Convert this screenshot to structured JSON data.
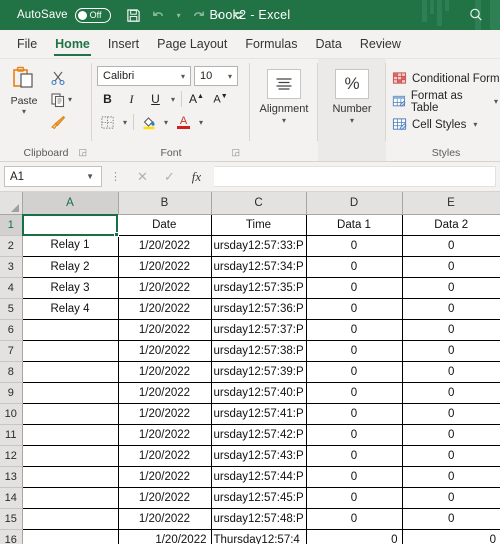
{
  "titlebar": {
    "autosave_label": "AutoSave",
    "autosave_state": "Off",
    "document_title": "Book2  -  Excel",
    "save_icon": "save-icon",
    "undo_icon": "undo-icon",
    "redo_icon": "redo-icon",
    "customize_icon": "customize-quick-access-icon",
    "search_icon": "search-icon",
    "accent_color": "#217346"
  },
  "tabs": [
    {
      "label": "File",
      "active": false
    },
    {
      "label": "Home",
      "active": true
    },
    {
      "label": "Insert",
      "active": false
    },
    {
      "label": "Page Layout",
      "active": false
    },
    {
      "label": "Formulas",
      "active": false
    },
    {
      "label": "Data",
      "active": false
    },
    {
      "label": "Review",
      "active": false
    }
  ],
  "ribbon": {
    "clipboard": {
      "group_label": "Clipboard",
      "paste_label": "Paste",
      "paste_icon": "paste-icon",
      "cut_icon": "cut-scissors-icon",
      "copy_icon": "copy-icon",
      "format_painter_icon": "format-painter-icon",
      "launcher_icon": "dialog-launcher-icon"
    },
    "font": {
      "group_label": "Font",
      "font_name": "Calibri",
      "font_size": "10",
      "bold_label": "B",
      "italic_label": "I",
      "underline_label": "U",
      "grow_font_label": "A",
      "shrink_font_label": "A",
      "borders_icon": "borders-icon",
      "fill_color_icon": "fill-color-icon",
      "font_color_label": "A",
      "launcher_icon": "dialog-launcher-icon"
    },
    "alignment": {
      "group_label": "Alignment",
      "icon": "alignment-icon"
    },
    "number": {
      "group_label": "Number",
      "icon": "percent-icon"
    },
    "styles": {
      "group_label": "Styles",
      "items": [
        {
          "label": "Conditional Form",
          "icon": "conditional-formatting-icon"
        },
        {
          "label": "Format as Table",
          "icon": "format-as-table-icon"
        },
        {
          "label": "Cell Styles",
          "icon": "cell-styles-icon"
        }
      ]
    }
  },
  "formula_bar": {
    "name_box_value": "A1",
    "dropdown_icon": "chevron-down-icon",
    "menu_dots_icon": "vertical-dots-icon",
    "cancel_icon": "cancel-icon",
    "enter_icon": "enter-checkmark-icon",
    "function_icon": "insert-function-fx-icon",
    "formula_value": ""
  },
  "sheet": {
    "selected_cell": "A1",
    "column_headers": [
      "A",
      "B",
      "C",
      "D",
      "E"
    ],
    "row_numbers": [
      "1",
      "2",
      "3",
      "4",
      "5",
      "6",
      "7",
      "8",
      "9",
      "10",
      "11",
      "12",
      "13",
      "14",
      "15",
      "16"
    ],
    "rows": [
      {
        "num": "1",
        "A": "",
        "B": "Date",
        "C": "Time",
        "D": "Data 1",
        "E": "Data 2",
        "align": "center"
      },
      {
        "num": "2",
        "A": "Relay 1",
        "B": "1/20/2022",
        "C": "ursday12:57:33:P",
        "D": "0",
        "E": "0",
        "align": "center"
      },
      {
        "num": "3",
        "A": "Relay  2",
        "B": "1/20/2022",
        "C": "ursday12:57:34:P",
        "D": "0",
        "E": "0",
        "align": "center"
      },
      {
        "num": "4",
        "A": "Relay 3",
        "B": "1/20/2022",
        "C": "ursday12:57:35:P",
        "D": "0",
        "E": "0",
        "align": "center"
      },
      {
        "num": "5",
        "A": "Relay 4",
        "B": "1/20/2022",
        "C": "ursday12:57:36:P",
        "D": "0",
        "E": "0",
        "align": "center"
      },
      {
        "num": "6",
        "A": "",
        "B": "1/20/2022",
        "C": "ursday12:57:37:P",
        "D": "0",
        "E": "0",
        "align": "center"
      },
      {
        "num": "7",
        "A": "",
        "B": "1/20/2022",
        "C": "ursday12:57:38:P",
        "D": "0",
        "E": "0",
        "align": "center"
      },
      {
        "num": "8",
        "A": "",
        "B": "1/20/2022",
        "C": "ursday12:57:39:P",
        "D": "0",
        "E": "0",
        "align": "center"
      },
      {
        "num": "9",
        "A": "",
        "B": "1/20/2022",
        "C": "ursday12:57:40:P",
        "D": "0",
        "E": "0",
        "align": "center"
      },
      {
        "num": "10",
        "A": "",
        "B": "1/20/2022",
        "C": "ursday12:57:41:P",
        "D": "0",
        "E": "0",
        "align": "center"
      },
      {
        "num": "11",
        "A": "",
        "B": "1/20/2022",
        "C": "ursday12:57:42:P",
        "D": "0",
        "E": "0",
        "align": "center"
      },
      {
        "num": "12",
        "A": "",
        "B": "1/20/2022",
        "C": "ursday12:57:43:P",
        "D": "0",
        "E": "0",
        "align": "center"
      },
      {
        "num": "13",
        "A": "",
        "B": "1/20/2022",
        "C": "ursday12:57:44:P",
        "D": "0",
        "E": "0",
        "align": "center"
      },
      {
        "num": "14",
        "A": "",
        "B": "1/20/2022",
        "C": "ursday12:57:45:P",
        "D": "0",
        "E": "0",
        "align": "center"
      },
      {
        "num": "15",
        "A": "",
        "B": "1/20/2022",
        "C": "ursday12:57:48:P",
        "D": "0",
        "E": "0",
        "align": "center"
      },
      {
        "num": "16",
        "A": "",
        "B": "1/20/2022",
        "C": "Thursday12:57:4",
        "D": "0",
        "E": "0",
        "align": "right"
      }
    ]
  }
}
